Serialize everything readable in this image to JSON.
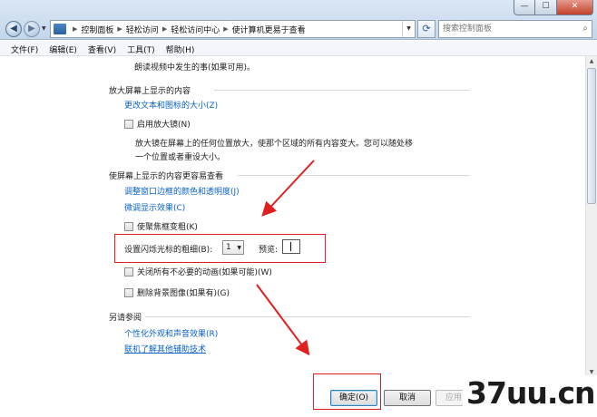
{
  "titlebar": {
    "window_buttons": {
      "minimize": "—",
      "maximize": "☐",
      "close": "✕"
    },
    "breadcrumb": [
      "控制面板",
      "轻松访问",
      "轻松访问中心",
      "使计算机更易于查看"
    ],
    "search_placeholder": "搜索控制面板"
  },
  "menu": [
    "文件(F)",
    "编辑(E)",
    "查看(V)",
    "工具(T)",
    "帮助(H)"
  ],
  "content": {
    "top_line": "朗读视频中发生的事(如果可用)。",
    "section_magnify": {
      "header": "放大屏幕上显示的内容",
      "link_text_size": "更改文本和图标的大小(Z)",
      "checkbox_magnifier": "启用放大镜(N)",
      "desc_line1": "放大镜在屏幕上的任何位置放大，使那个区域的所有内容变大。您可以随处移",
      "desc_line2": "一个位置或者重设大小。"
    },
    "section_easier": {
      "header": "使屏幕上显示的内容更容易查看",
      "link_window_color": "调整窗口边框的颜色和透明度(J)",
      "link_display_effects": "微调显示效果(C)",
      "checkbox_focus": "使聚焦框变粗(K)",
      "cursor_label": "设置闪烁光标的粗细(B):",
      "cursor_value": "1",
      "preview_label": "预览:",
      "checkbox_animations": "关闭所有不必要的动画(如果可能)(W)",
      "checkbox_background": "删除背景图像(如果有)(G)"
    },
    "section_see_also": {
      "header": "另请参阅",
      "link_personalize": "个性化外观和声音效果(R)",
      "link_assistive": "联机了解其他辅助技术"
    }
  },
  "buttons": {
    "ok": "确定(O)",
    "cancel": "取消",
    "apply": "应用"
  },
  "watermark": "37uu.cn",
  "colors": {
    "annotation": "#e02020",
    "link": "#0b63c9"
  }
}
